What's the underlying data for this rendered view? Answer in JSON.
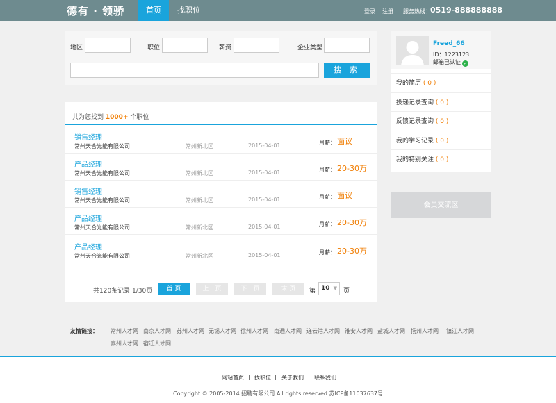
{
  "header": {
    "logo": "德有 · 领骄",
    "nav_home": "首页",
    "nav_jobs": "找职位",
    "login": "登录",
    "register": "注册",
    "separator": "|",
    "hotline_label": "服务热线：",
    "hotline": "0519-888888888"
  },
  "search": {
    "region_label": "地区",
    "position_label": "职位",
    "salary_label": "薪资",
    "company_type_label": "企业类型",
    "region_value": "",
    "position_value": "",
    "salary_value": "",
    "company_type_value": "",
    "keyword_value": "",
    "search_button": "搜 索"
  },
  "results": {
    "prefix": "共为您找到",
    "count": "1000+",
    "suffix": "个职位",
    "salary_label": "月薪：",
    "jobs": [
      {
        "title": "销售经理",
        "company": "常州天合光能有限公司",
        "location": "常州新北区",
        "date": "2015-04-01",
        "salary": "面议"
      },
      {
        "title": "产品经理",
        "company": "常州天合光能有限公司",
        "location": "常州新北区",
        "date": "2015-04-01",
        "salary": "20-30万"
      },
      {
        "title": "销售经理",
        "company": "常州天合光能有限公司",
        "location": "常州新北区",
        "date": "2015-04-01",
        "salary": "面议"
      },
      {
        "title": "产品经理",
        "company": "常州天合光能有限公司",
        "location": "常州新北区",
        "date": "2015-04-01",
        "salary": "20-30万"
      },
      {
        "title": "产品经理",
        "company": "常州天合光能有限公司",
        "location": "常州新北区",
        "date": "2015-04-01",
        "salary": "20-30万"
      }
    ]
  },
  "pager": {
    "total": "共120条记录  1/30页",
    "first": "首 页",
    "prev": "上一页",
    "next": "下一页",
    "last": "末 页",
    "page_prefix": "第",
    "page_value": "10",
    "page_suffix": "页"
  },
  "profile": {
    "username": "Freed_66",
    "id": "ID：1223123",
    "verified": "邮箱已认证",
    "items": [
      {
        "label": "我的简历",
        "count": "( 0 )"
      },
      {
        "label": "投递记录查询",
        "count": "( 0 )"
      },
      {
        "label": "反馈记录查询",
        "count": "( 0 )"
      },
      {
        "label": "我的学习记录",
        "count": "( 0 )"
      },
      {
        "label": "我的特别关注",
        "count": "( 0 )"
      }
    ],
    "member_button": "会员交流区"
  },
  "footer": {
    "links_label": "友情链接：",
    "links": [
      "常州人才网",
      "南京人才网",
      "苏州人才网",
      "无锡人才网",
      "徐州人才网",
      "南通人才网",
      "连云港人才网",
      "淮安人才网",
      "盐城人才网",
      "扬州人才网",
      "镇江人才网",
      "泰州人才网",
      "宿迁人才网"
    ],
    "nav": [
      "网站首页",
      "找职位",
      "关于我们",
      "联系我们"
    ],
    "separator": "|",
    "copyright": "Copyright © 2005-2014 招聘有限公司 All rights reserved 苏ICP备11037637号"
  },
  "colors": {
    "header": "#6e8b8f",
    "accent": "#1aa4dc",
    "salary": "#f07c00",
    "verified": "#2cb14a"
  }
}
